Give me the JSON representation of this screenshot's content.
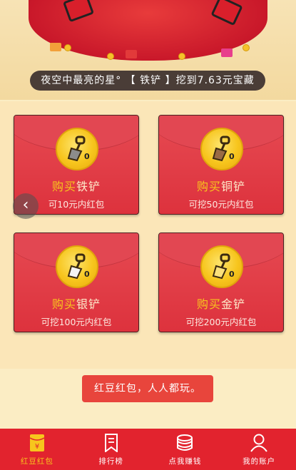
{
  "ticker": {
    "text": "夜空中最亮的星° 【 铁铲 】挖到7.63元宝藏"
  },
  "buy_label": "购买",
  "cards": [
    {
      "kind": "铁铲",
      "sub": "可10元内红包",
      "shovel_color": "#8c8c8c"
    },
    {
      "kind": "铜铲",
      "sub": "可挖50元内红包",
      "shovel_color": "#9a6a45"
    },
    {
      "kind": "银铲",
      "sub": "可挖100元内红包",
      "shovel_color": "#d8d8d8"
    },
    {
      "kind": "金铲",
      "sub": "可挖200元内红包",
      "shovel_color": "#f2c23a"
    }
  ],
  "medal_badge": "0",
  "prev_arrow": "‹",
  "slogan": "红豆红包，人人都玩。",
  "tabs": [
    {
      "label": "红豆红包",
      "icon": "red-envelope-icon",
      "glyph": "¥",
      "active": true
    },
    {
      "label": "排行榜",
      "icon": "bookmark-icon",
      "active": false
    },
    {
      "label": "点我赚钱",
      "icon": "coins-icon",
      "active": false
    },
    {
      "label": "我的账户",
      "icon": "user-icon",
      "active": false
    }
  ],
  "colors": {
    "accent": "#e2232e",
    "gold": "#f7c51d",
    "background": "#fbedc4"
  }
}
